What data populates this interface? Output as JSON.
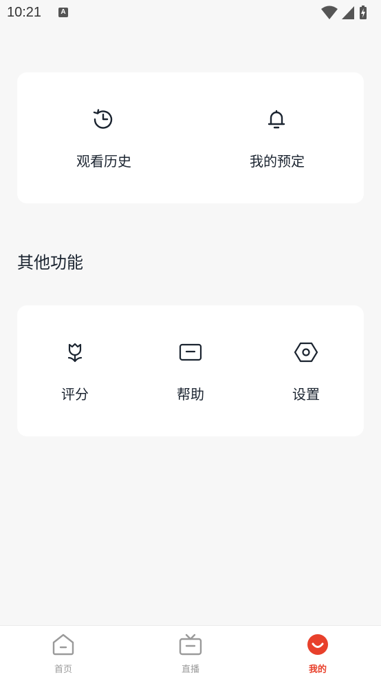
{
  "status_bar": {
    "time": "10:21",
    "notification_badge": "A",
    "icons": [
      "wifi-icon",
      "signal-icon",
      "battery-charging-icon"
    ]
  },
  "top_card": {
    "items": [
      {
        "label": "观看历史",
        "icon": "history-clock-icon"
      },
      {
        "label": "我的预定",
        "icon": "bell-icon"
      }
    ]
  },
  "other_section": {
    "title": "其他功能",
    "items": [
      {
        "label": "评分",
        "icon": "flower-icon"
      },
      {
        "label": "帮助",
        "icon": "message-box-icon"
      },
      {
        "label": "设置",
        "icon": "hexagon-settings-icon"
      }
    ]
  },
  "bottom_nav": {
    "items": [
      {
        "label": "首页",
        "icon": "home-icon",
        "active": false
      },
      {
        "label": "直播",
        "icon": "tv-icon",
        "active": false
      },
      {
        "label": "我的",
        "icon": "profile-smile-icon",
        "active": true
      }
    ]
  },
  "colors": {
    "background": "#f7f7f7",
    "card": "#ffffff",
    "text": "#1b2430",
    "accent": "#e8402b",
    "inactive": "#9a9a9a"
  }
}
